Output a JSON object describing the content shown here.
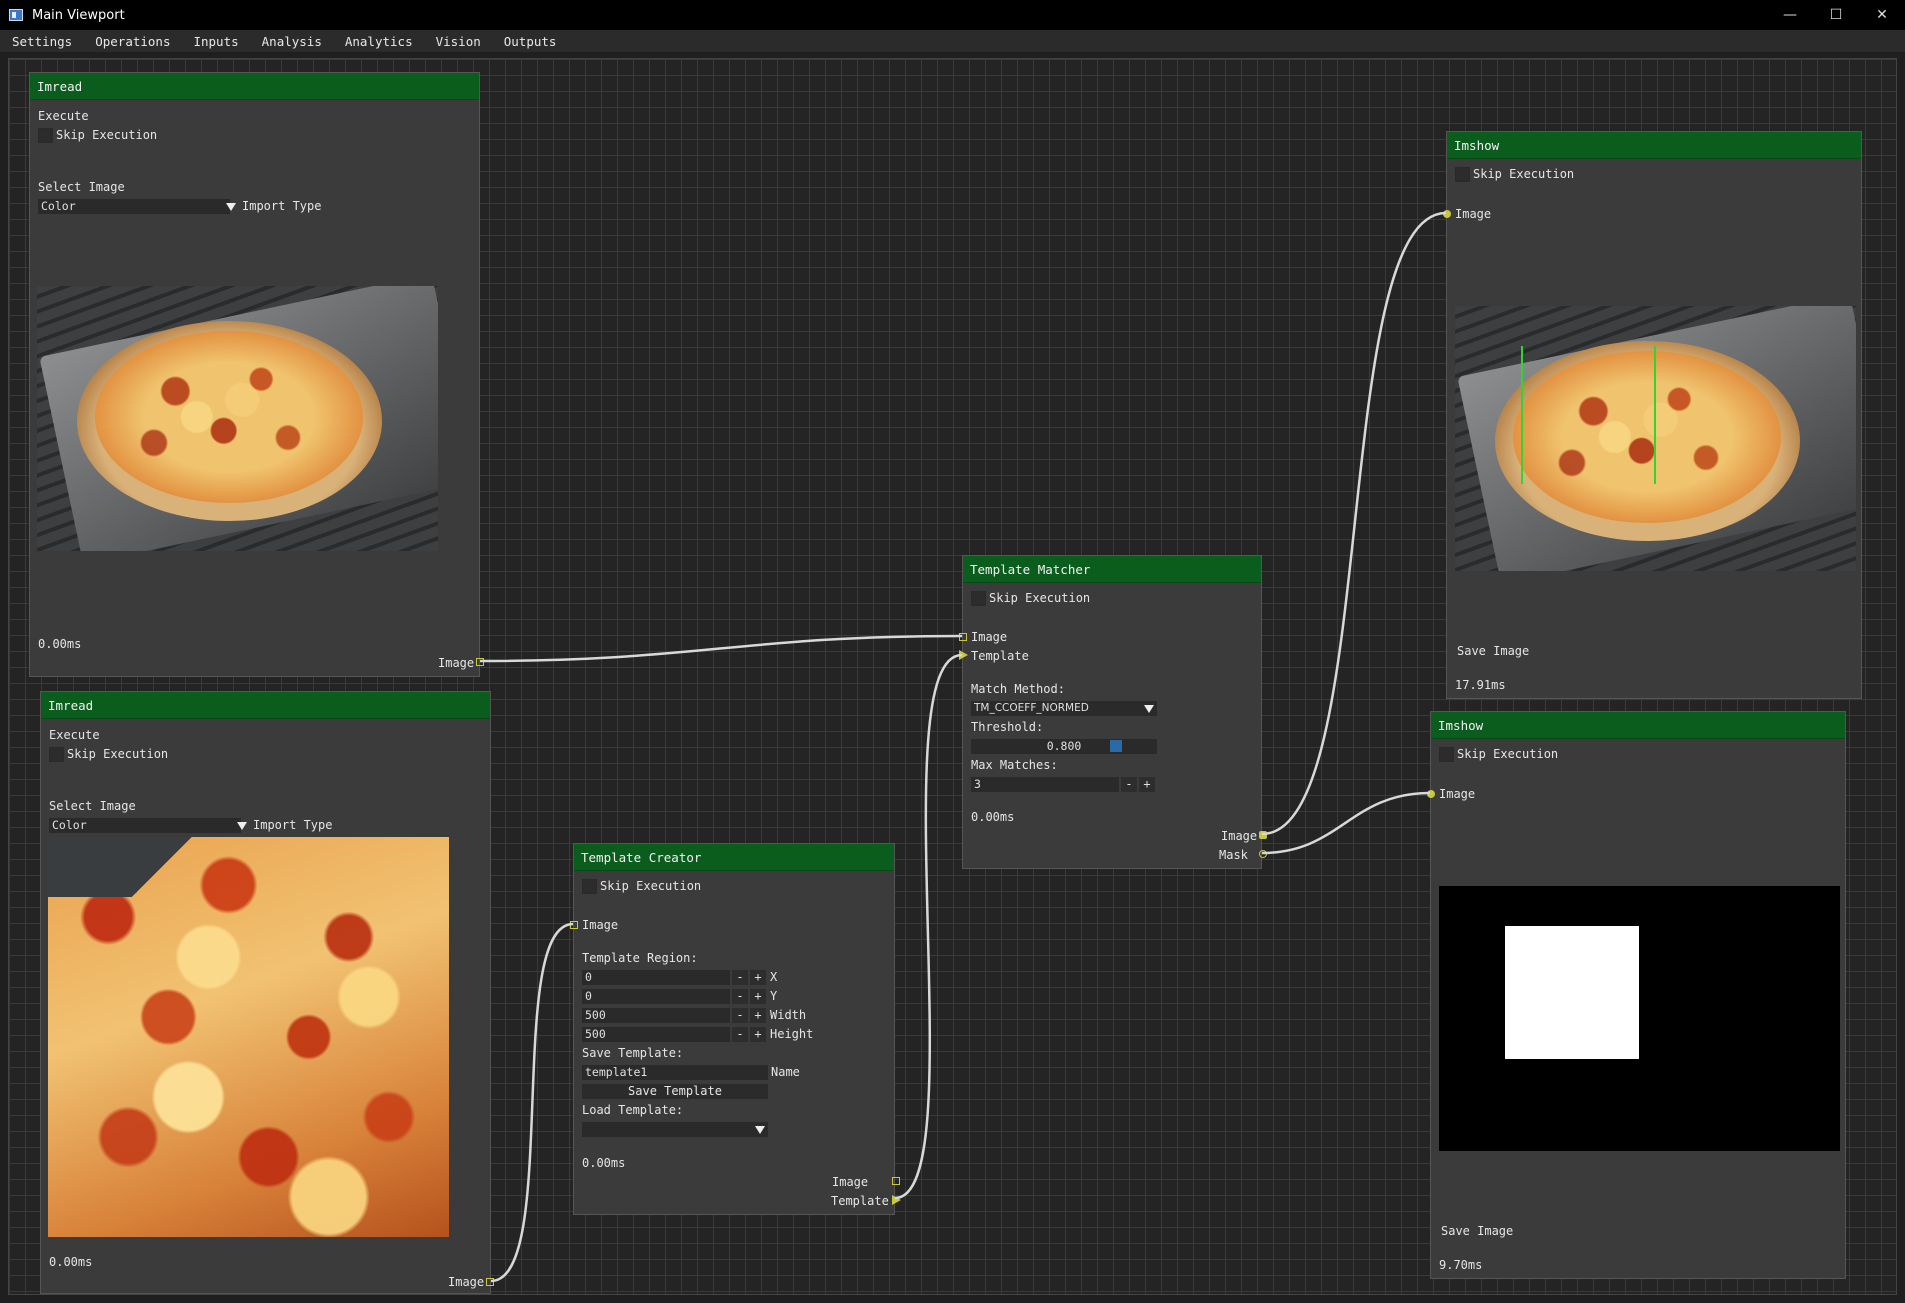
{
  "window": {
    "title": "Main Viewport",
    "minimize": "—",
    "maximize": "☐",
    "close": "✕"
  },
  "menu": [
    "Settings",
    "Operations",
    "Inputs",
    "Analysis",
    "Analytics",
    "Vision",
    "Outputs"
  ],
  "nodes": {
    "imread1": {
      "title": "Imread",
      "execute": "Execute",
      "skip": "Skip Execution",
      "select_image": "Select Image",
      "import_value": "Color",
      "import_label": "Import Type",
      "timing": "0.00ms",
      "out_image": "Image"
    },
    "imread2": {
      "title": "Imread",
      "execute": "Execute",
      "skip": "Skip Execution",
      "select_image": "Select Image",
      "import_value": "Color",
      "import_label": "Import Type",
      "timing": "0.00ms",
      "out_image": "Image"
    },
    "template_creator": {
      "title": "Template Creator",
      "skip": "Skip Execution",
      "in_image": "Image",
      "region_label": "Template Region:",
      "x_value": "0",
      "x_label": "X",
      "y_value": "0",
      "y_label": "Y",
      "w_value": "500",
      "w_label": "Width",
      "h_value": "500",
      "h_label": "Height",
      "save_label": "Save Template:",
      "name_value": "template1",
      "name_label": "Name",
      "save_button": "Save Template",
      "load_label": "Load Template:",
      "load_value": "",
      "timing": "0.00ms",
      "out_image": "Image",
      "out_template": "Template",
      "minus": "-",
      "plus": "+"
    },
    "template_matcher": {
      "title": "Template Matcher",
      "skip": "Skip Execution",
      "in_image": "Image",
      "in_template": "Template",
      "method_label": "Match Method:",
      "method_value": "TM_CCOEFF_NORMED",
      "threshold_label": "Threshold:",
      "threshold_value": "0.800",
      "threshold": 0.8,
      "max_label": "Max Matches:",
      "max_value": "3",
      "timing": "0.00ms",
      "out_image": "Image",
      "out_mask": "Mask",
      "minus": "-",
      "plus": "+"
    },
    "imshow1": {
      "title": "Imshow",
      "skip": "Skip Execution",
      "in_image": "Image",
      "save": "Save Image",
      "timing": "17.91ms"
    },
    "imshow2": {
      "title": "Imshow",
      "skip": "Skip Execution",
      "in_image": "Image",
      "save": "Save Image",
      "timing": "9.70ms"
    }
  },
  "colors": {
    "header": "#0b5d1e",
    "pin": "#c8c83c",
    "wire": "#d8d8d8",
    "match_line": "#2fd62f"
  }
}
